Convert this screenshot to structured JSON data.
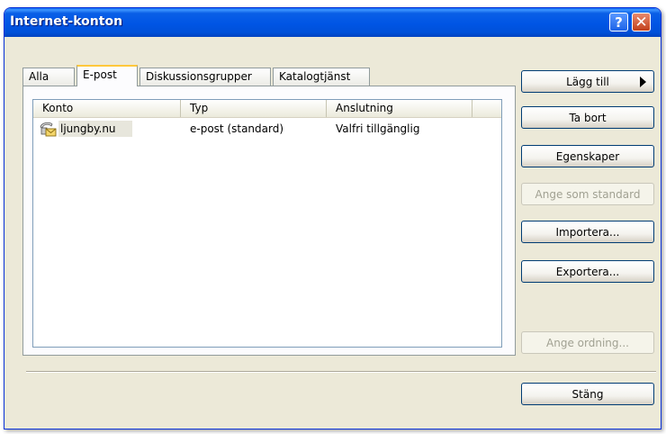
{
  "window": {
    "title": "Internet-konton",
    "help_label": "?",
    "close_label": "✕"
  },
  "tabs": [
    {
      "label": "Alla",
      "active": false
    },
    {
      "label": "E-post",
      "active": true
    },
    {
      "label": "Diskussionsgrupper",
      "active": false
    },
    {
      "label": "Katalogtjänst",
      "active": false
    }
  ],
  "list": {
    "columns": [
      "Konto",
      "Typ",
      "Anslutning"
    ],
    "rows": [
      {
        "account": "ljungby.nu",
        "type": "e-post (standard)",
        "connection": "Valfri tillgänglig",
        "icon": "mail-account-icon"
      }
    ]
  },
  "buttons": {
    "add": "Lägg till",
    "remove": "Ta bort",
    "properties": "Egenskaper",
    "set_default": "Ange som standard",
    "import": "Importera...",
    "export": "Exportera...",
    "set_order": "Ange ordning...",
    "close": "Stäng"
  },
  "colors": {
    "titlebar": "#0055e5",
    "window_bg": "#ece9d8",
    "active_tab_accent": "#ffc83c"
  }
}
